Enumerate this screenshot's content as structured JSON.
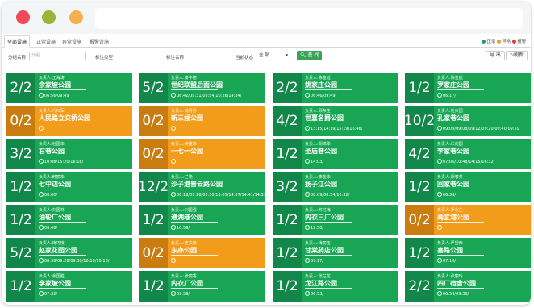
{
  "tabs": [
    "全部设施",
    "正常设施",
    "异常设施",
    "报警设施"
  ],
  "legend": [
    {
      "label": "正常",
      "color": "#18a654"
    },
    {
      "label": "异常",
      "color": "#f29c1c"
    },
    {
      "label": "报警",
      "color": "#e23d3d"
    }
  ],
  "filter": {
    "name_label": "分组名称",
    "name_placeholder": "分组",
    "type_label": "标注类型",
    "tag_label": "标注名称",
    "status_label": "当前状态",
    "status_value": "全 部",
    "search_label": "查 找",
    "export_label": "导 出",
    "refresh_label": "刷新"
  },
  "person_prefix": "负责人:",
  "cards": [
    {
      "ratio": "2/2",
      "person": "王海涛",
      "park": "余家坡公园",
      "times": "06:56/09:49",
      "status": "green"
    },
    {
      "ratio": "5/2",
      "person": "秦丰德",
      "park": "世纪联盟后面公园",
      "times": "06:42/09:31/09:54/10:26/14:34/",
      "status": "green"
    },
    {
      "ratio": "2/2",
      "person": "陈金延",
      "park": "姚家庄公园",
      "times": "06:46/09:49",
      "status": "green"
    },
    {
      "ratio": "1/2",
      "person": "陈金延",
      "park": "罗家庄公园",
      "times": "06:17/",
      "status": "green"
    },
    {
      "ratio": "0/2",
      "person": "代红军",
      "park": "人民路立交桥公园",
      "times": "",
      "status": "orange"
    },
    {
      "ratio": "0/2",
      "person": "冯丹丹",
      "park": "新三线公园",
      "times": "",
      "status": "orange"
    },
    {
      "ratio": "4/2",
      "person": "顾东生",
      "park": "世嘉名爵公园",
      "times": "13:15/14:19/15:19/16:46/",
      "status": "green"
    },
    {
      "ratio": "10/2",
      "person": "杜兴国",
      "park": "孔家巷公园",
      "times": "09:09/09:08/09:12/09:20/09:40/09:59",
      "status": "green"
    },
    {
      "ratio": "3/2",
      "person": "杜国华",
      "park": "右巷公园",
      "times": "10:08/15:20/16:18/",
      "status": "green"
    },
    {
      "ratio": "0/2",
      "person": "黄建华",
      "park": "一七一公园",
      "times": "",
      "status": "orange"
    },
    {
      "ratio": "1/2",
      "person": "胡锦华",
      "park": "圣庙巷公园",
      "times": "14:03/",
      "status": "green"
    },
    {
      "ratio": "4/2",
      "person": "江向国",
      "park": "李家巷公园",
      "times": "07:06/10:48/14:15/16:32/",
      "status": "green"
    },
    {
      "ratio": "1/2",
      "person": "韩丽华",
      "park": "七中边公园",
      "times": "08:00/",
      "status": "green"
    },
    {
      "ratio": "12/2",
      "person": "兰艳",
      "park": "沙子港普云路公园",
      "times": "06:18/09:18/09:30/13:05/14:37/14:41/14:51/",
      "status": "green"
    },
    {
      "ratio": "3/2",
      "person": "李金华",
      "park": "扬子江公园",
      "times": "08:09/08:54/10:32/",
      "status": "green"
    },
    {
      "ratio": "1/2",
      "person": "廖春英",
      "park": "回家巷公园",
      "times": "06:38/",
      "status": "green"
    },
    {
      "ratio": "1/2",
      "person": "刘国林",
      "park": "油轮厂公园",
      "times": "06:46/",
      "status": "green"
    },
    {
      "ratio": "1/2",
      "person": "刘国强",
      "park": "通湖巷公园",
      "times": "10:59/",
      "status": "green"
    },
    {
      "ratio": "1/2",
      "person": "苏柱梅",
      "park": "内衣三厂公园",
      "times": "12:50/",
      "status": "green"
    },
    {
      "ratio": "0/2",
      "person": "罗永生",
      "park": "两宜港公园",
      "times": "",
      "status": "orange"
    },
    {
      "ratio": "5/2",
      "person": "梅巧枝",
      "park": "赵家花园公园",
      "times": "08:38/09:28/09:38/10:10/10:18/",
      "status": "green"
    },
    {
      "ratio": "0/2",
      "person": "史文静",
      "park": "东办公园",
      "times": "",
      "status": "orange"
    },
    {
      "ratio": "1/2",
      "person": "梅丽玉",
      "park": "甘棠药店公园",
      "times": "07:17/",
      "status": "green"
    },
    {
      "ratio": "1/2",
      "person": "严望西",
      "park": "塞路公园",
      "times": "07:18/",
      "status": "green"
    },
    {
      "ratio": "1/2",
      "person": "余国胜",
      "park": "李家坡公园",
      "times": "07:32/",
      "status": "green"
    },
    {
      "ratio": "1/2",
      "person": "张丽香",
      "park": "内衣厂公园",
      "times": "09:59/",
      "status": "green"
    },
    {
      "ratio": "1/2",
      "person": "张兰花",
      "park": "龙江路公园",
      "times": "06:53/",
      "status": "green"
    },
    {
      "ratio": "2/2",
      "person": "张丽玲",
      "park": "四厂宿舍公园",
      "times": "06:59/09:38/",
      "status": "green"
    }
  ]
}
